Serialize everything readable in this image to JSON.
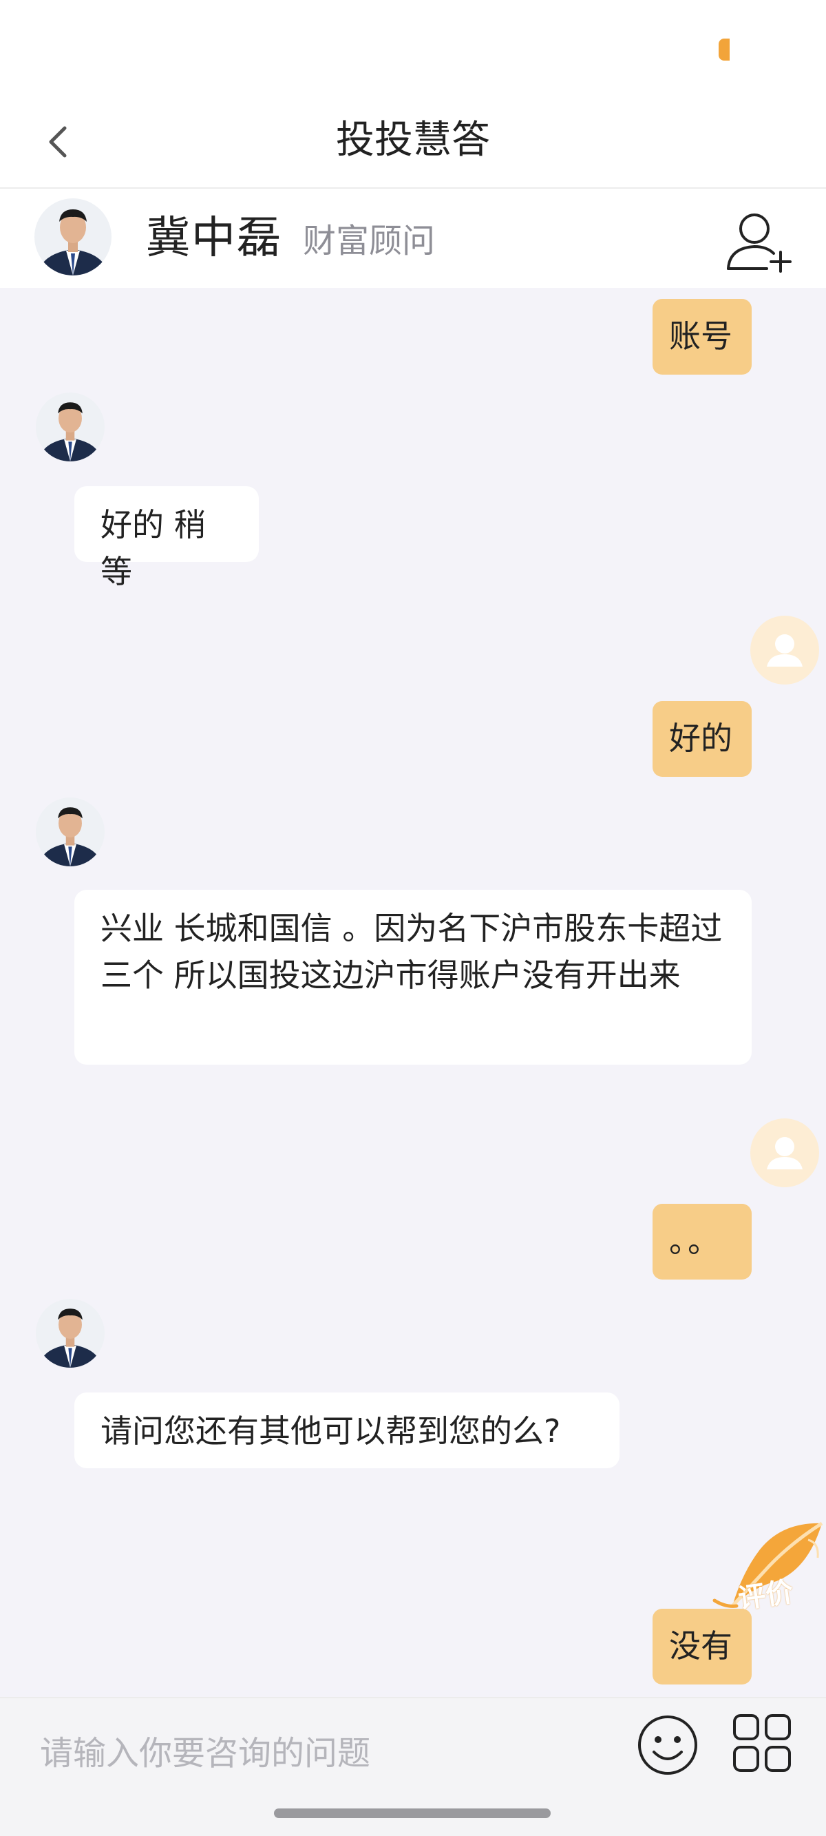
{
  "nav": {
    "title": "投投慧答"
  },
  "advisor": {
    "name": "冀中磊",
    "role": "财富顾问"
  },
  "messages": [
    {
      "side": "out",
      "text": "账号"
    },
    {
      "side": "in",
      "text": "好的 稍等"
    },
    {
      "side": "out",
      "text": "好的"
    },
    {
      "side": "in",
      "text": "兴业 长城和国信 。因为名下沪市股东卡超过三个 所以国投这边沪市得账户没有开出来"
    },
    {
      "side": "out",
      "text": "。。"
    },
    {
      "side": "in",
      "text": "请问您还有其他可以帮到您的么?"
    },
    {
      "side": "out",
      "text": "没有"
    }
  ],
  "rate_button": {
    "label": "评价",
    "icon": "feather-icon"
  },
  "input": {
    "placeholder": "请输入你要咨询的问题",
    "value": ""
  },
  "icons": {
    "back": "chevron-left-icon",
    "add_contact": "add-user-icon",
    "emoji": "smiley-icon",
    "more": "grid-icon"
  },
  "colors": {
    "outgoing_bubble": "#f7cd88",
    "incoming_bubble": "#ffffff",
    "background": "#f4f3f9",
    "accent": "#f2a43a"
  }
}
